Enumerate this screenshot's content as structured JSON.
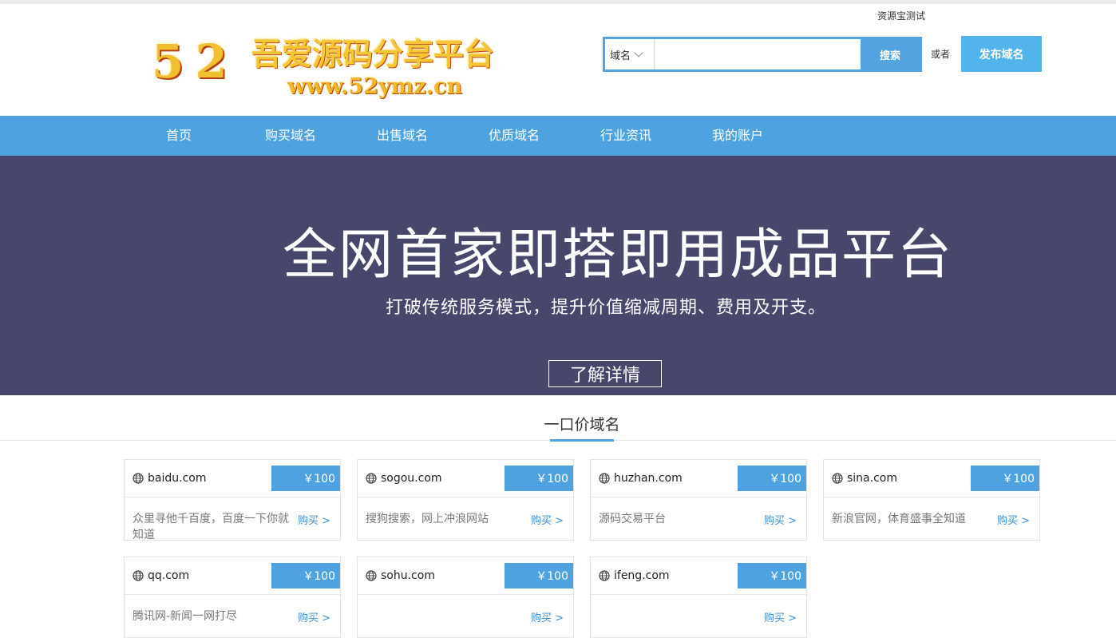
{
  "header": {
    "logo_number": "52",
    "logo_title": "吾爱源码分享平台",
    "logo_url": "www.52ymz.cn",
    "site_name": "资源宝测试",
    "search_type": "域名",
    "search_placeholder": "",
    "search_button": "搜索",
    "or_text": "或者",
    "publish_button": "发布域名"
  },
  "nav": {
    "items": [
      "首页",
      "购买域名",
      "出售域名",
      "优质域名",
      "行业资讯",
      "我的账户"
    ]
  },
  "banner": {
    "title": "全网首家即搭即用成品平台",
    "subtitle": "打破传统服务模式，提升价值缩减周期、费用及开支。",
    "button": "了解详情"
  },
  "section": {
    "title": "一口价域名"
  },
  "domains": [
    {
      "name": "baidu.com",
      "price": "￥100",
      "desc": "众里寻他千百度，百度一下你就知道",
      "buy": "购买 >"
    },
    {
      "name": "sogou.com",
      "price": "￥100",
      "desc": "搜狗搜索，网上冲浪网站",
      "buy": "购买 >"
    },
    {
      "name": "huzhan.com",
      "price": "￥100",
      "desc": "源码交易平台",
      "buy": "购买 >"
    },
    {
      "name": "sina.com",
      "price": "￥100",
      "desc": "新浪官网，体育盛事全知道",
      "buy": "购买 >"
    },
    {
      "name": "qq.com",
      "price": "￥100",
      "desc": "腾讯网-新闻一网打尽",
      "buy": "购买 >"
    },
    {
      "name": "sohu.com",
      "price": "￥100",
      "desc": "",
      "buy": "购买 >"
    },
    {
      "name": "ifeng.com",
      "price": "￥100",
      "desc": "",
      "buy": "购买 >"
    }
  ],
  "colors": {
    "accent_blue": "#4da2df",
    "banner_bg": "#47476b",
    "publish_blue": "#52b4ea"
  }
}
